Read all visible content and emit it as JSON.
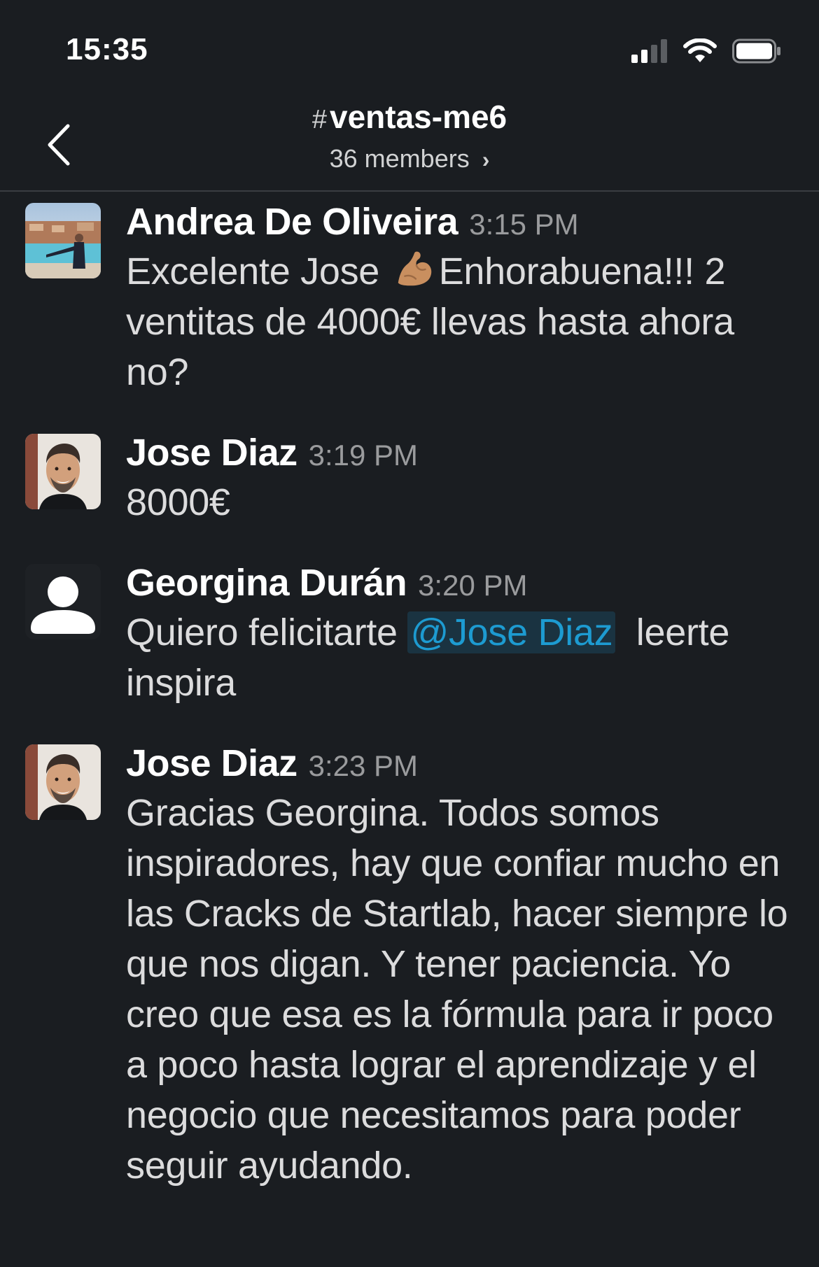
{
  "status_bar": {
    "time": "15:35"
  },
  "header": {
    "channel_hash": "#",
    "channel_name": "ventas-me6",
    "members": "36 members"
  },
  "messages": [
    {
      "author": "Andrea De Oliveira",
      "time": "3:15 PM",
      "text_before_emoji": "Excelente Jose ",
      "emoji": "flexed-biceps",
      "text_after_emoji": "Enhorabuena!!! 2 ventitas de 4000€ llevas hasta ahora no?"
    },
    {
      "author": "Jose Diaz",
      "time": "3:19 PM",
      "text": "8000€"
    },
    {
      "author": "Georgina Durán",
      "time": "3:20 PM",
      "text_before_mention": "Quiero felicitarte ",
      "mention": "@Jose Diaz",
      "text_after_mention": "  leerte inspira"
    },
    {
      "author": "Jose Diaz",
      "time": "3:23 PM",
      "text": "Gracias Georgina. Todos somos inspiradores, hay que confiar mucho en las Cracks de Startlab, hacer siempre lo que nos digan. Y tener paciencia. Yo creo que esa es la fórmula para ir poco a poco hasta lograr el aprendizaje y el negocio que necesitamos para poder seguir ayudando."
    }
  ],
  "colors": {
    "background": "#1a1d21",
    "mention": "#1d9bd1",
    "timestamp": "#9a9b9d"
  }
}
